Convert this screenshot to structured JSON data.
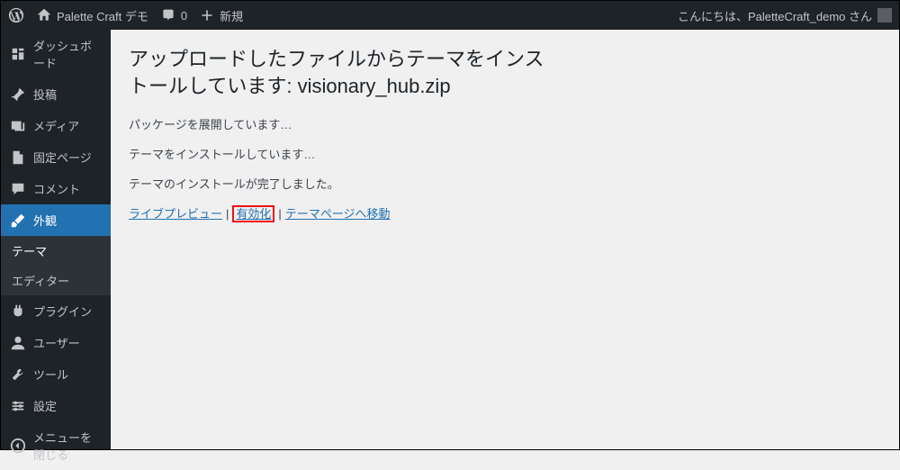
{
  "adminbar": {
    "site_name": "Palette Craft デモ",
    "comments_count": "0",
    "new_label": "新規",
    "greeting": "こんにちは、PaletteCraft_demo さん"
  },
  "sidebar": {
    "dashboard": "ダッシュボード",
    "posts": "投稿",
    "media": "メディア",
    "pages": "固定ページ",
    "comments": "コメント",
    "appearance": "外観",
    "themes": "テーマ",
    "editor": "エディター",
    "plugins": "プラグイン",
    "users": "ユーザー",
    "tools": "ツール",
    "settings": "設定",
    "collapse": "メニューを閉じる"
  },
  "main": {
    "heading": "アップロードしたファイルからテーマをインストールしています: visionary_hub.zip",
    "msg1": "パッケージを展開しています…",
    "msg2": "テーマをインストールしています…",
    "msg3": "テーマのインストールが完了しました。",
    "link_preview": "ライブプレビュー",
    "link_activate": "有効化",
    "link_themes": "テーマページへ移動"
  }
}
